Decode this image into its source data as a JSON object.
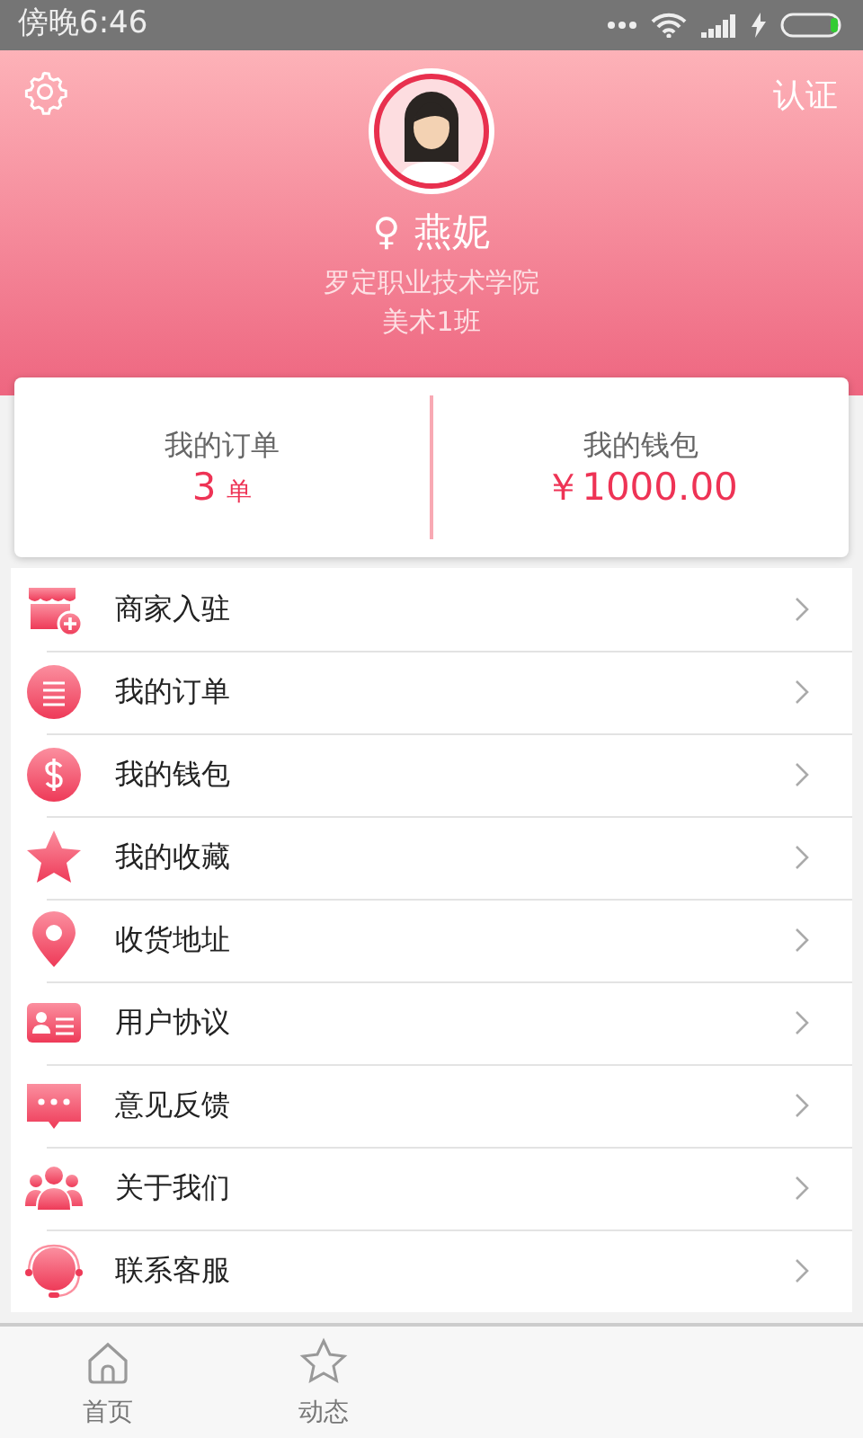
{
  "status_bar": {
    "time": "傍晚6:46"
  },
  "profile": {
    "action": "认证",
    "gender": "♀",
    "name": "燕妮",
    "school": "罗定职业技术学院",
    "class": "美术1班"
  },
  "summary": [
    {
      "label": "我的订单",
      "value": "3",
      "unit": "单"
    },
    {
      "label": "我的钱包",
      "value": "￥1000.00"
    }
  ],
  "menu": [
    {
      "label": "商家入驻"
    },
    {
      "label": "我的订单"
    },
    {
      "label": "我的钱包"
    },
    {
      "label": "我的收藏"
    },
    {
      "label": "收货地址"
    },
    {
      "label": "用户协议"
    },
    {
      "label": "意见反馈"
    },
    {
      "label": "关于我们"
    },
    {
      "label": "联系客服"
    }
  ],
  "tab_bar": [
    {
      "label": "首页",
      "selected": false
    },
    {
      "label": "动态",
      "selected": false
    }
  ]
}
